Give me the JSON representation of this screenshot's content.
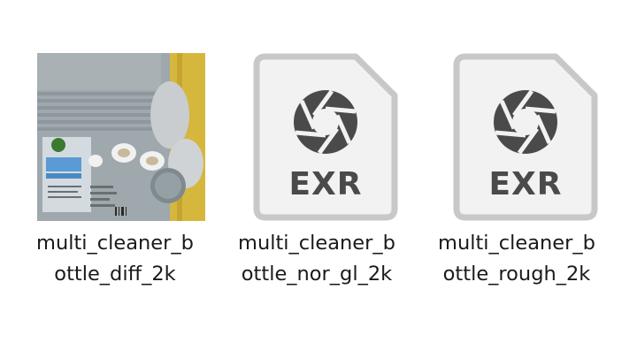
{
  "files": [
    {
      "line1": "multi_cleaner_b",
      "line2": "ottle_diff_2k",
      "icon": "texture-thumbnail-icon",
      "badge": ""
    },
    {
      "line1": "multi_cleaner_b",
      "line2": "ottle_nor_gl_2k",
      "icon": "exr-file-icon",
      "badge": "EXR"
    },
    {
      "line1": "multi_cleaner_b",
      "line2": "ottle_rough_2k",
      "icon": "exr-file-icon",
      "badge": "EXR"
    }
  ],
  "colors": {
    "page_bg": "#ffffff",
    "icon_fill": "#f2f2f2",
    "icon_border": "#c8c8c8",
    "icon_glyph": "#4a4a4a",
    "texture_yellow": "#d8b63a",
    "texture_gray": "#9aa3a8"
  }
}
